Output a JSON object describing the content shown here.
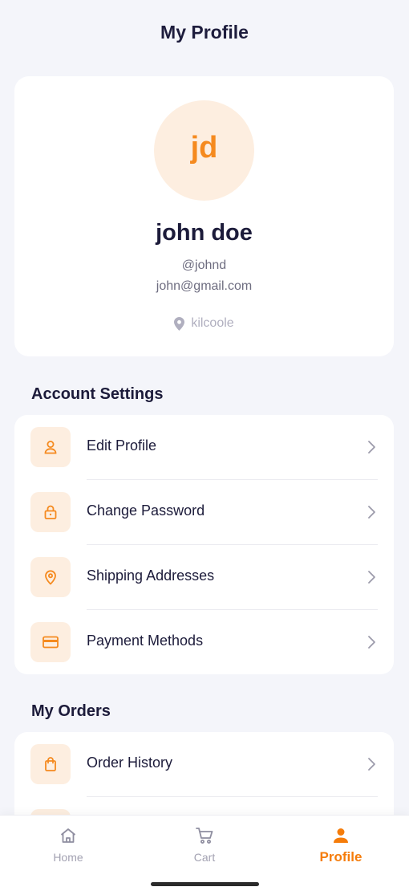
{
  "header": {
    "title": "My Profile"
  },
  "profile": {
    "initials": "jd",
    "name": "john doe",
    "username": "@johnd",
    "email": "john@gmail.com",
    "location": "kilcoole"
  },
  "account_settings": {
    "title": "Account Settings",
    "items": [
      {
        "label": "Edit Profile",
        "icon": "user-icon"
      },
      {
        "label": "Change Password",
        "icon": "lock-icon"
      },
      {
        "label": "Shipping Addresses",
        "icon": "map-pin-icon"
      },
      {
        "label": "Payment Methods",
        "icon": "credit-card-icon"
      }
    ]
  },
  "my_orders": {
    "title": "My Orders",
    "items": [
      {
        "label": "Order History",
        "icon": "shopping-bag-icon"
      }
    ]
  },
  "bottom_nav": {
    "items": [
      {
        "label": "Home",
        "icon": "home-icon",
        "active": false
      },
      {
        "label": "Cart",
        "icon": "cart-icon",
        "active": false
      },
      {
        "label": "Profile",
        "icon": "person-icon",
        "active": true
      }
    ]
  },
  "colors": {
    "accent": "#f57c0a",
    "accent_soft": "#fdeee0",
    "background": "#f4f5fa",
    "text_primary": "#1c1b3a",
    "text_muted": "#6e6d80"
  }
}
